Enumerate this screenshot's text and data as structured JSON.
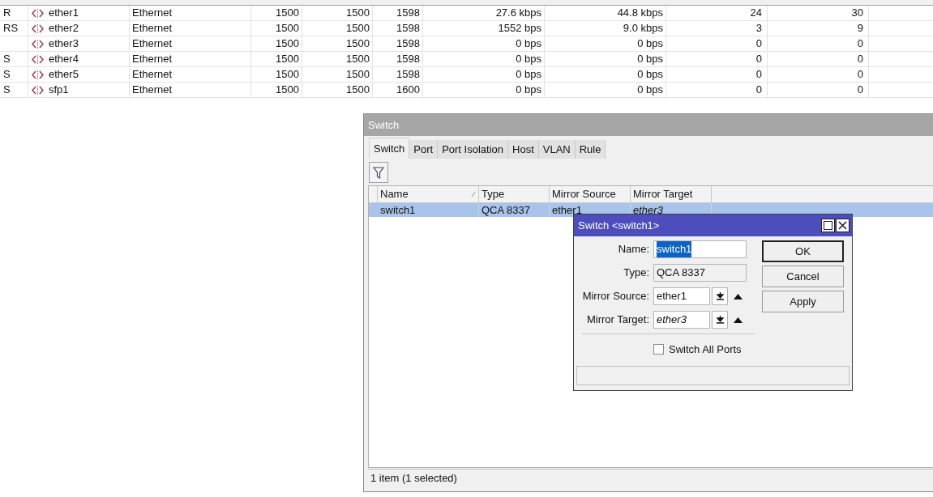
{
  "interfaces": {
    "rows": [
      {
        "flags": "R",
        "name": "ether1",
        "type": "Ethernet",
        "mtu": "1500",
        "actual_mtu": "1500",
        "l2_mtu": "1598",
        "tx": "27.6 kbps",
        "rx": "44.8 kbps",
        "tx_packet": "24",
        "rx_packet": "30"
      },
      {
        "flags": "RS",
        "name": "ether2",
        "type": "Ethernet",
        "mtu": "1500",
        "actual_mtu": "1500",
        "l2_mtu": "1598",
        "tx": "1552 bps",
        "rx": "9.0 kbps",
        "tx_packet": "3",
        "rx_packet": "9"
      },
      {
        "flags": "",
        "name": "ether3",
        "type": "Ethernet",
        "mtu": "1500",
        "actual_mtu": "1500",
        "l2_mtu": "1598",
        "tx": "0 bps",
        "rx": "0 bps",
        "tx_packet": "0",
        "rx_packet": "0"
      },
      {
        "flags": "S",
        "name": "ether4",
        "type": "Ethernet",
        "mtu": "1500",
        "actual_mtu": "1500",
        "l2_mtu": "1598",
        "tx": "0 bps",
        "rx": "0 bps",
        "tx_packet": "0",
        "rx_packet": "0"
      },
      {
        "flags": "S",
        "name": "ether5",
        "type": "Ethernet",
        "mtu": "1500",
        "actual_mtu": "1500",
        "l2_mtu": "1598",
        "tx": "0 bps",
        "rx": "0 bps",
        "tx_packet": "0",
        "rx_packet": "0"
      },
      {
        "flags": "S",
        "name": "sfp1",
        "type": "Ethernet",
        "mtu": "1500",
        "actual_mtu": "1500",
        "l2_mtu": "1600",
        "tx": "0 bps",
        "rx": "0 bps",
        "tx_packet": "0",
        "rx_packet": "0"
      }
    ]
  },
  "switch_window": {
    "title": "Switch",
    "tabs": [
      {
        "label": "Switch",
        "selected": true
      },
      {
        "label": "Port",
        "selected": false
      },
      {
        "label": "Port Isolation",
        "selected": false
      },
      {
        "label": "Host",
        "selected": false
      },
      {
        "label": "VLAN",
        "selected": false
      },
      {
        "label": "Rule",
        "selected": false
      }
    ],
    "table": {
      "columns": [
        {
          "label": "Name",
          "sorted": true
        },
        {
          "label": "Type",
          "sorted": false
        },
        {
          "label": "Mirror Source",
          "sorted": false
        },
        {
          "label": "Mirror Target",
          "sorted": false
        }
      ],
      "rows": [
        {
          "selected": true,
          "cells": [
            "switch1",
            "QCA 8337",
            "ether1",
            "ether3"
          ]
        }
      ]
    },
    "status_bar": "1 item (1 selected)"
  },
  "dialog": {
    "title": "Switch <switch1>",
    "fields": [
      {
        "kind": "text",
        "label": "Name:",
        "value": "switch1",
        "text_selected": true
      },
      {
        "kind": "readonly",
        "label": "Type:",
        "value": "QCA 8337"
      },
      {
        "kind": "dropdown",
        "label": "Mirror Source:",
        "value": "ether1",
        "italic": false
      },
      {
        "kind": "dropdown",
        "label": "Mirror Target:",
        "value": "ether3",
        "italic": true
      }
    ],
    "checkbox": {
      "label": "Switch All Ports",
      "checked": false
    },
    "buttons": [
      {
        "label": "OK",
        "default": true
      },
      {
        "label": "Cancel",
        "default": false
      },
      {
        "label": "Apply",
        "default": false
      }
    ]
  }
}
